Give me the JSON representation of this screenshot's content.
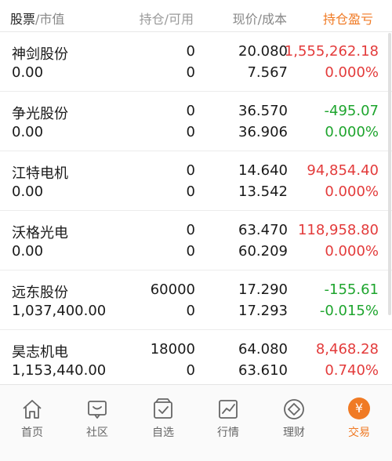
{
  "header": {
    "col1_a": "股票",
    "col1_sep": "/",
    "col1_b": "市值",
    "col2": "持仓/可用",
    "col3": "现价/成本",
    "col4": "持仓盈亏"
  },
  "colors": {
    "accent": "#f07a24",
    "gain": "#e33b3b",
    "loss": "#1ea52e"
  },
  "holdings": [
    {
      "name": "神剑股份",
      "market_value": "0.00",
      "position": "0",
      "available": "0",
      "price": "20.080",
      "cost": "7.567",
      "pl": "1,555,262.18",
      "pl_pct": "0.000%",
      "pl_color": "red",
      "pct_color": "red"
    },
    {
      "name": "争光股份",
      "market_value": "0.00",
      "position": "0",
      "available": "0",
      "price": "36.570",
      "cost": "36.906",
      "pl": "-495.07",
      "pl_pct": "0.000%",
      "pl_color": "green",
      "pct_color": "green"
    },
    {
      "name": "江特电机",
      "market_value": "0.00",
      "position": "0",
      "available": "0",
      "price": "14.640",
      "cost": "13.542",
      "pl": "94,854.40",
      "pl_pct": "0.000%",
      "pl_color": "red",
      "pct_color": "red"
    },
    {
      "name": "沃格光电",
      "market_value": "0.00",
      "position": "0",
      "available": "0",
      "price": "63.470",
      "cost": "60.209",
      "pl": "118,958.80",
      "pl_pct": "0.000%",
      "pl_color": "red",
      "pct_color": "red"
    },
    {
      "name": "远东股份",
      "market_value": "1,037,400.00",
      "position": "60000",
      "available": "0",
      "price": "17.290",
      "cost": "17.293",
      "pl": "-155.61",
      "pl_pct": "-0.015%",
      "pl_color": "green",
      "pct_color": "green"
    },
    {
      "name": "昊志机电",
      "market_value": "1,153,440.00",
      "position": "18000",
      "available": "0",
      "price": "64.080",
      "cost": "63.610",
      "pl": "8,468.28",
      "pl_pct": "0.740%",
      "pl_color": "red",
      "pct_color": "red"
    }
  ],
  "tabbar": [
    {
      "label": "首页",
      "icon": "home-icon"
    },
    {
      "label": "社区",
      "icon": "community-icon"
    },
    {
      "label": "自选",
      "icon": "watchlist-icon"
    },
    {
      "label": "行情",
      "icon": "market-chart-icon"
    },
    {
      "label": "理财",
      "icon": "wealth-diamond-icon"
    },
    {
      "label": "交易",
      "icon": "yen-coin-icon",
      "active": true
    }
  ],
  "trade_icon_glyph": "¥"
}
